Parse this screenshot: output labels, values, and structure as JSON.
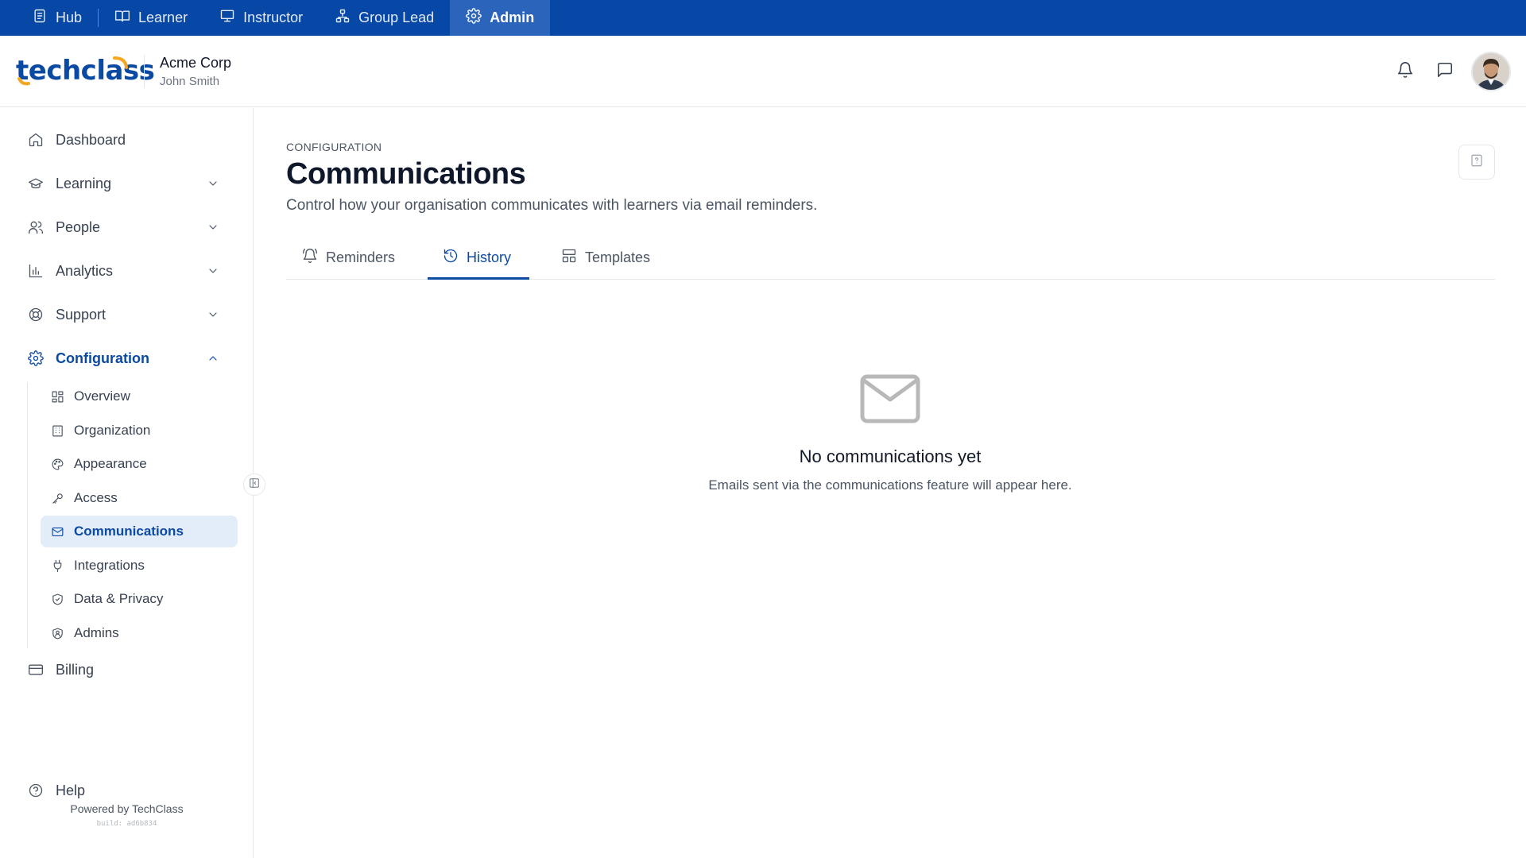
{
  "roles": [
    {
      "label": "Hub",
      "icon": "hub-icon"
    },
    {
      "label": "Learner",
      "icon": "book-icon"
    },
    {
      "label": "Instructor",
      "icon": "presentation-icon"
    },
    {
      "label": "Group Lead",
      "icon": "network-icon"
    },
    {
      "label": "Admin",
      "icon": "gear-icon",
      "active": true
    }
  ],
  "header": {
    "logo_text": "techclass",
    "org_name": "Acme Corp",
    "user_name": "John Smith"
  },
  "sidebar": {
    "items": [
      {
        "label": "Dashboard",
        "icon": "home-icon"
      },
      {
        "label": "Learning",
        "icon": "graduation-cap-icon"
      },
      {
        "label": "People",
        "icon": "users-icon"
      },
      {
        "label": "Analytics",
        "icon": "bar-chart-icon"
      },
      {
        "label": "Support",
        "icon": "lifebuoy-icon"
      },
      {
        "label": "Configuration",
        "icon": "gear-icon"
      },
      {
        "label": "Billing",
        "icon": "credit-card-icon"
      },
      {
        "label": "Help",
        "icon": "help-circle-icon"
      }
    ],
    "config_items": [
      {
        "label": "Overview",
        "icon": "grid-icon"
      },
      {
        "label": "Organization",
        "icon": "building-icon"
      },
      {
        "label": "Appearance",
        "icon": "palette-icon"
      },
      {
        "label": "Access",
        "icon": "key-icon"
      },
      {
        "label": "Communications",
        "icon": "mail-icon",
        "active": true
      },
      {
        "label": "Integrations",
        "icon": "plug-icon"
      },
      {
        "label": "Data & Privacy",
        "icon": "shield-check-icon"
      },
      {
        "label": "Admins",
        "icon": "shield-user-icon"
      }
    ],
    "powered_by": "Powered by TechClass",
    "build": "build: ad6b834"
  },
  "page": {
    "eyebrow": "CONFIGURATION",
    "title": "Communications",
    "subtitle": "Control how your organisation communicates with learners via email reminders."
  },
  "tabs": [
    {
      "label": "Reminders",
      "icon": "bell-ring-icon"
    },
    {
      "label": "History",
      "icon": "history-icon",
      "active": true
    },
    {
      "label": "Templates",
      "icon": "template-icon"
    }
  ],
  "empty_state": {
    "icon": "mail-icon",
    "title": "No communications yet",
    "description": "Emails sent via the communications feature will appear here."
  },
  "colors": {
    "brand": "#0b4aa2",
    "rolebar": "#0747a6",
    "rolebar_active": "#2a64bb",
    "active_bg": "#e3ecf9",
    "accent_orange": "#f5a623"
  }
}
